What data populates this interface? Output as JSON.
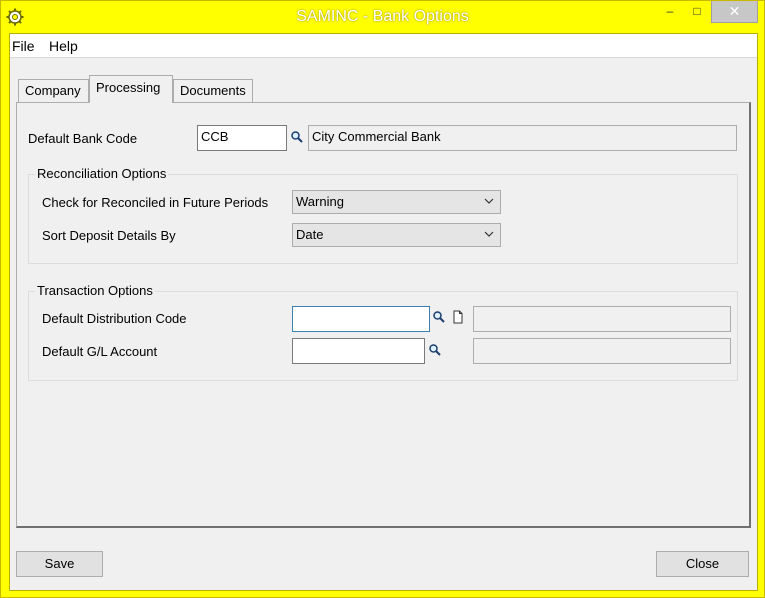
{
  "window": {
    "title": "SAMINC - Bank Options",
    "minimize_glyph": "‒",
    "maximize_glyph": "□",
    "close_glyph": "✕"
  },
  "menu": {
    "items": [
      "File",
      "Help"
    ]
  },
  "tabs": [
    {
      "label": "Company",
      "active": false
    },
    {
      "label": "Processing",
      "active": true
    },
    {
      "label": "Documents",
      "active": false
    }
  ],
  "processing": {
    "default_bank_code_label": "Default Bank Code",
    "default_bank_code_value": "CCB",
    "default_bank_name": "City Commercial Bank",
    "reconciliation": {
      "title": "Reconciliation Options",
      "check_future_label": "Check for Reconciled in Future Periods",
      "check_future_value": "Warning",
      "sort_deposit_label": "Sort Deposit Details By",
      "sort_deposit_value": "Date"
    },
    "transaction": {
      "title": "Transaction Options",
      "distribution_code_label": "Default Distribution Code",
      "distribution_code_value": "",
      "distribution_code_desc": "",
      "gl_account_label": "Default G/L Account",
      "gl_account_value": "",
      "gl_account_desc": ""
    }
  },
  "buttons": {
    "save": "Save",
    "close": "Close"
  },
  "icons": {
    "app": "gear-icon",
    "finder": "magnifier-icon",
    "new_doc": "new-document-icon",
    "dropdown": "chevron-down-icon"
  }
}
